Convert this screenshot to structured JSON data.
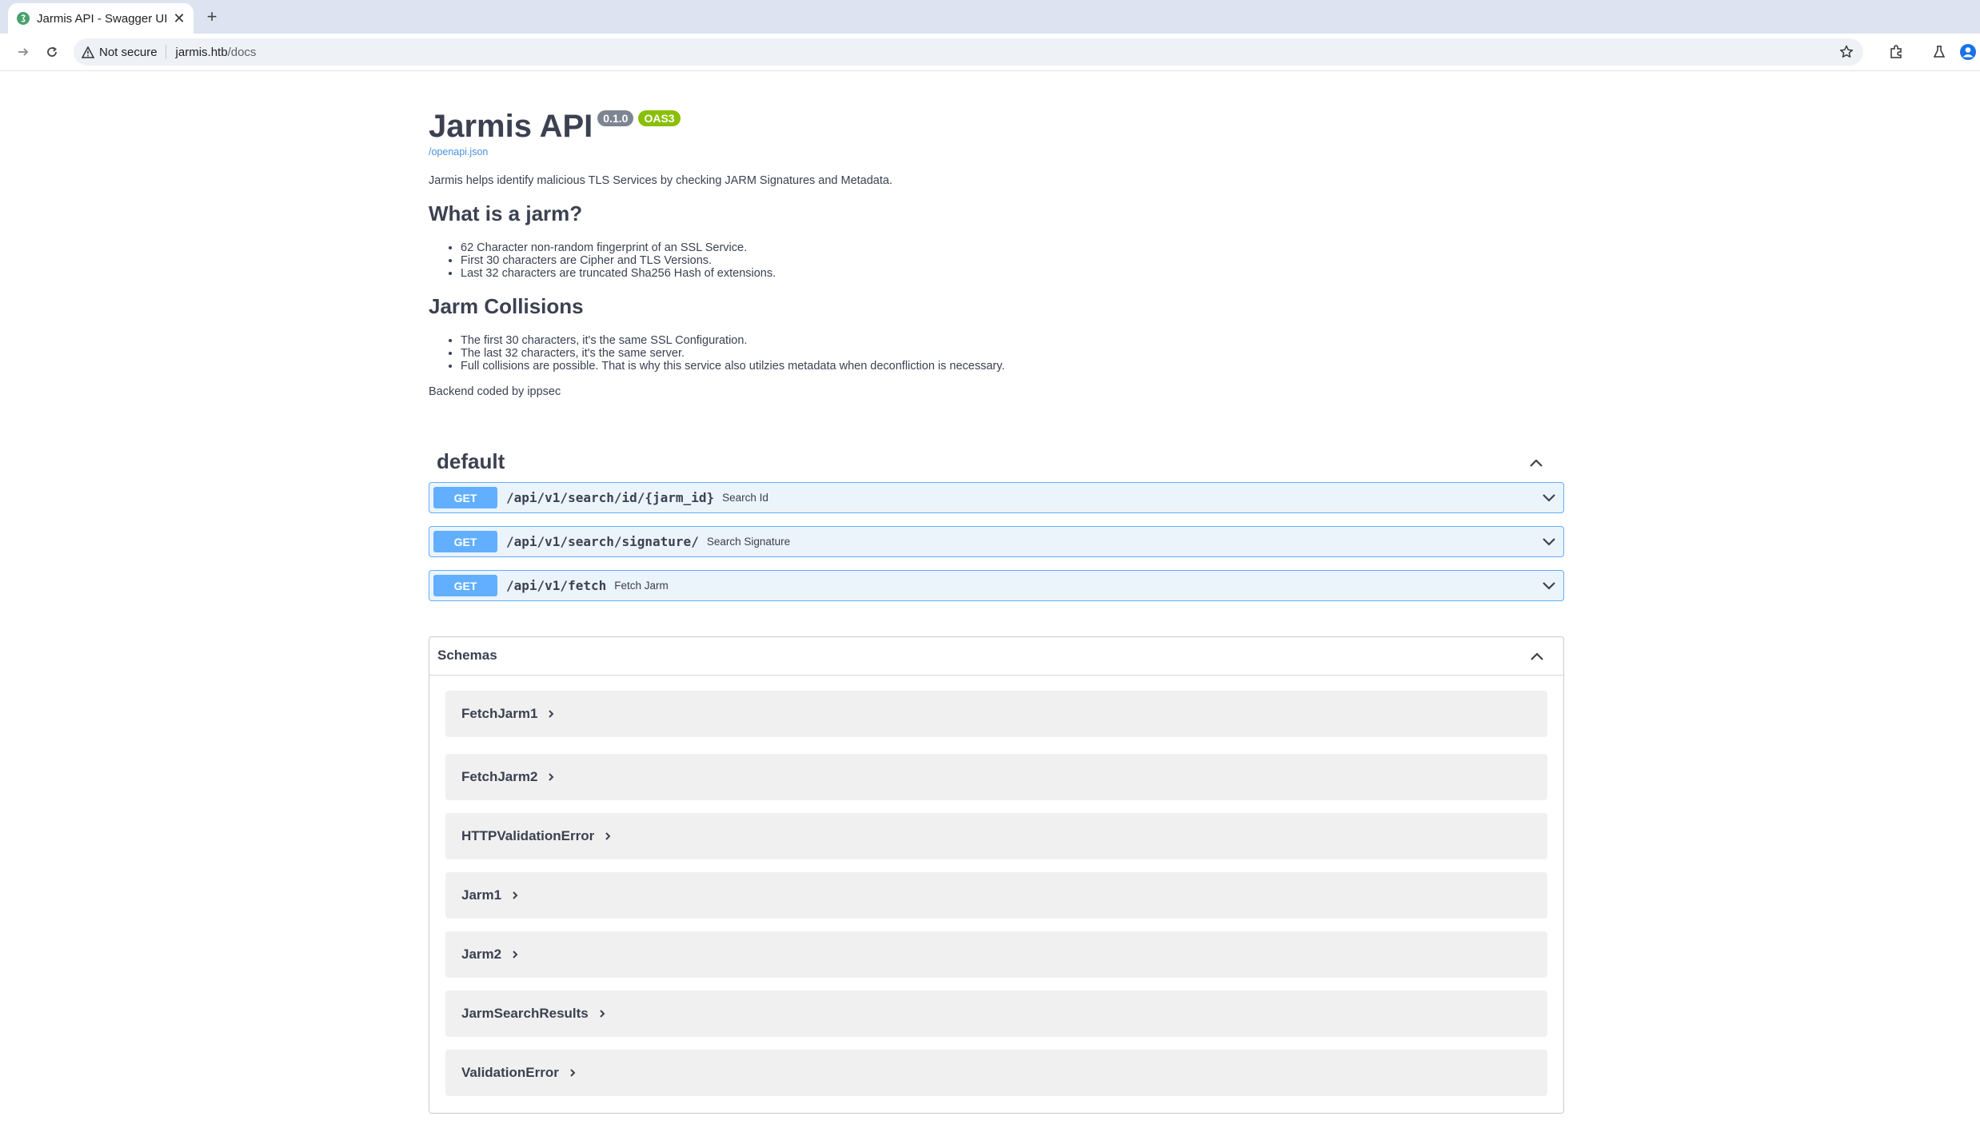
{
  "browser": {
    "tab_title": "Jarmis API - Swagger UI",
    "new_tab_glyph": "+",
    "close_glyph": "✕",
    "security_label": "Not secure",
    "url_host": "jarmis.htb",
    "url_path": "/docs"
  },
  "api": {
    "title": "Jarmis API",
    "version": "0.1.0",
    "oas_badge": "OAS3",
    "spec_link": "/openapi.json",
    "description": "Jarmis helps identify malicious TLS Services by checking JARM Signatures and Metadata.",
    "section1": {
      "heading": "What is a jarm?",
      "items": [
        "62 Character non-random fingerprint of an SSL Service.",
        "First 30 characters are Cipher and TLS Versions.",
        "Last 32 characters are truncated Sha256 Hash of extensions."
      ]
    },
    "section2": {
      "heading": "Jarm Collisions",
      "items": [
        "The first 30 characters, it's the same SSL Configuration.",
        "The last 32 characters, it's the same server.",
        "Full collisions are possible. That is why this service also utilzies metadata when deconfliction is necessary."
      ]
    },
    "credit": "Backend coded by ippsec"
  },
  "tag": {
    "name": "default"
  },
  "operations": [
    {
      "method": "GET",
      "path": "/api/v1/search/id/{jarm_id}",
      "summary": "Search Id"
    },
    {
      "method": "GET",
      "path": "/api/v1/search/signature/",
      "summary": "Search Signature"
    },
    {
      "method": "GET",
      "path": "/api/v1/fetch",
      "summary": "Fetch Jarm"
    }
  ],
  "schemas": {
    "title": "Schemas",
    "models": [
      "FetchJarm1",
      "FetchJarm2",
      "HTTPValidationError",
      "Jarm1",
      "Jarm2",
      "JarmSearchResults",
      "ValidationError"
    ]
  },
  "colors": {
    "get_method": "#61affe",
    "get_background": "#ebf3fb",
    "version_badge": "#7d8492",
    "oas_badge": "#89bf04",
    "text": "#3b4151",
    "link": "#4990e2"
  }
}
